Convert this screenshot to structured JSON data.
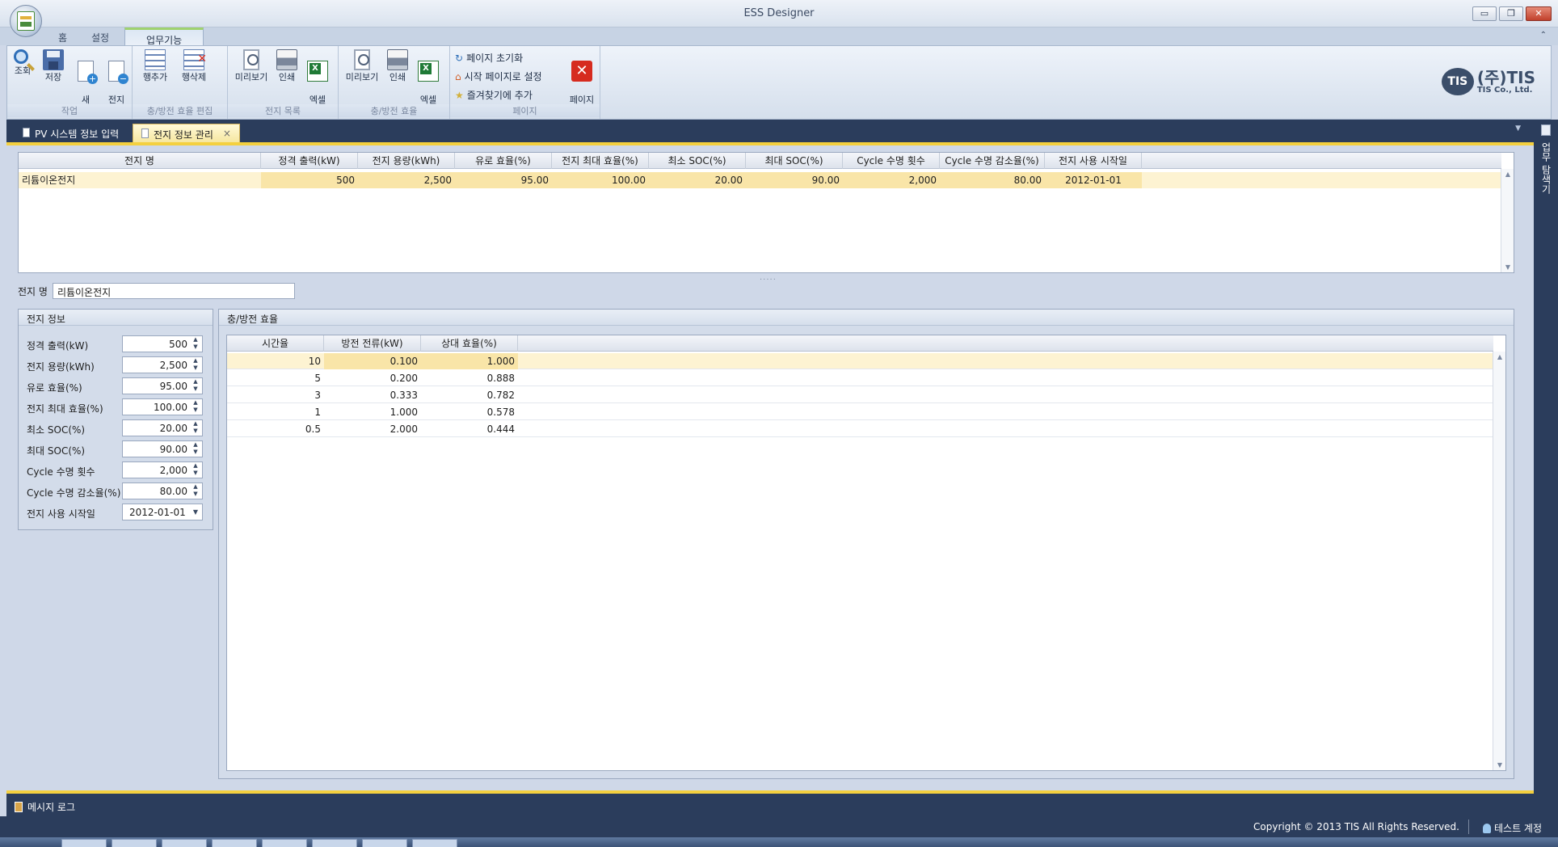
{
  "window": {
    "title": "ESS Designer"
  },
  "window_buttons": {
    "minimize": "▭",
    "restore": "❐",
    "close": "✕"
  },
  "ribbon_tabs": [
    "홈",
    "설정",
    "업무기능"
  ],
  "ribbon": {
    "groups": [
      {
        "label": "작업",
        "buttons": [
          "조회",
          "저장",
          "새\n전지",
          "전지\n삭제"
        ]
      },
      {
        "label": "충/방전 효율 편집",
        "buttons": [
          "행추가",
          "행삭제"
        ]
      },
      {
        "label": "전지 목록",
        "buttons": [
          "미리보기",
          "인쇄",
          "엑셀\n저장"
        ]
      },
      {
        "label": "충/방전 효율",
        "buttons": [
          "미리보기",
          "인쇄",
          "엑셀\n저장"
        ]
      },
      {
        "label": "페이지",
        "small_buttons": [
          "페이지 초기화",
          "시작 페이지로 설정",
          "즐겨찾기에 추가"
        ],
        "buttons": [
          "페이지\n닫기"
        ]
      }
    ]
  },
  "logo": {
    "mark": "TIS",
    "name": "(주)TIS",
    "sub": "TIS Co., Ltd."
  },
  "doc_tabs": [
    {
      "label": "PV 시스템 정보 입력",
      "active": false
    },
    {
      "label": "전지 정보 관리",
      "active": true,
      "close": "×"
    }
  ],
  "side_panel": {
    "label": "업무 탐색기"
  },
  "battery_list": {
    "columns": [
      "전지 명",
      "정격 출력(kW)",
      "전지 용량(kWh)",
      "유로 효율(%)",
      "전지 최대 효율(%)",
      "최소 SOC(%)",
      "최대 SOC(%)",
      "Cycle 수명 횟수",
      "Cycle 수명 감소율(%)",
      "전지 사용 시작일"
    ],
    "rows": [
      [
        "리튬이온전지",
        "500",
        "2,500",
        "95.00",
        "100.00",
        "20.00",
        "90.00",
        "2,000",
        "80.00",
        "2012-01-01"
      ]
    ]
  },
  "battery_name": {
    "label": "전지 명",
    "value": "리튬이온전지"
  },
  "battery_info": {
    "title": "전지 정보",
    "fields": [
      {
        "label": "정격 출력(kW)",
        "value": "500"
      },
      {
        "label": "전지 용량(kWh)",
        "value": "2,500"
      },
      {
        "label": "유로 효율(%)",
        "value": "95.00"
      },
      {
        "label": "전지 최대 효율(%)",
        "value": "100.00"
      },
      {
        "label": "최소 SOC(%)",
        "value": "20.00"
      },
      {
        "label": "최대 SOC(%)",
        "value": "90.00"
      },
      {
        "label": "Cycle 수명 횟수",
        "value": "2,000"
      },
      {
        "label": "Cycle 수명 감소율(%)",
        "value": "80.00"
      },
      {
        "label": "전지 사용 시작일",
        "value": "2012-01-01"
      }
    ]
  },
  "efficiency": {
    "title": "충/방전 효율",
    "columns": [
      "시간율",
      "방전 전류(kW)",
      "상대 효율(%)"
    ],
    "rows": [
      [
        "10",
        "0.100",
        "1.000"
      ],
      [
        "5",
        "0.200",
        "0.888"
      ],
      [
        "3",
        "0.333",
        "0.782"
      ],
      [
        "1",
        "1.000",
        "0.578"
      ],
      [
        "0.5",
        "2.000",
        "0.444"
      ]
    ]
  },
  "message_log": {
    "label": "메시지 로그"
  },
  "status": {
    "copyright": "Copyright © 2013 TIS All Rights Reserved.",
    "account": "테스트 계정"
  },
  "splitter": "....."
}
